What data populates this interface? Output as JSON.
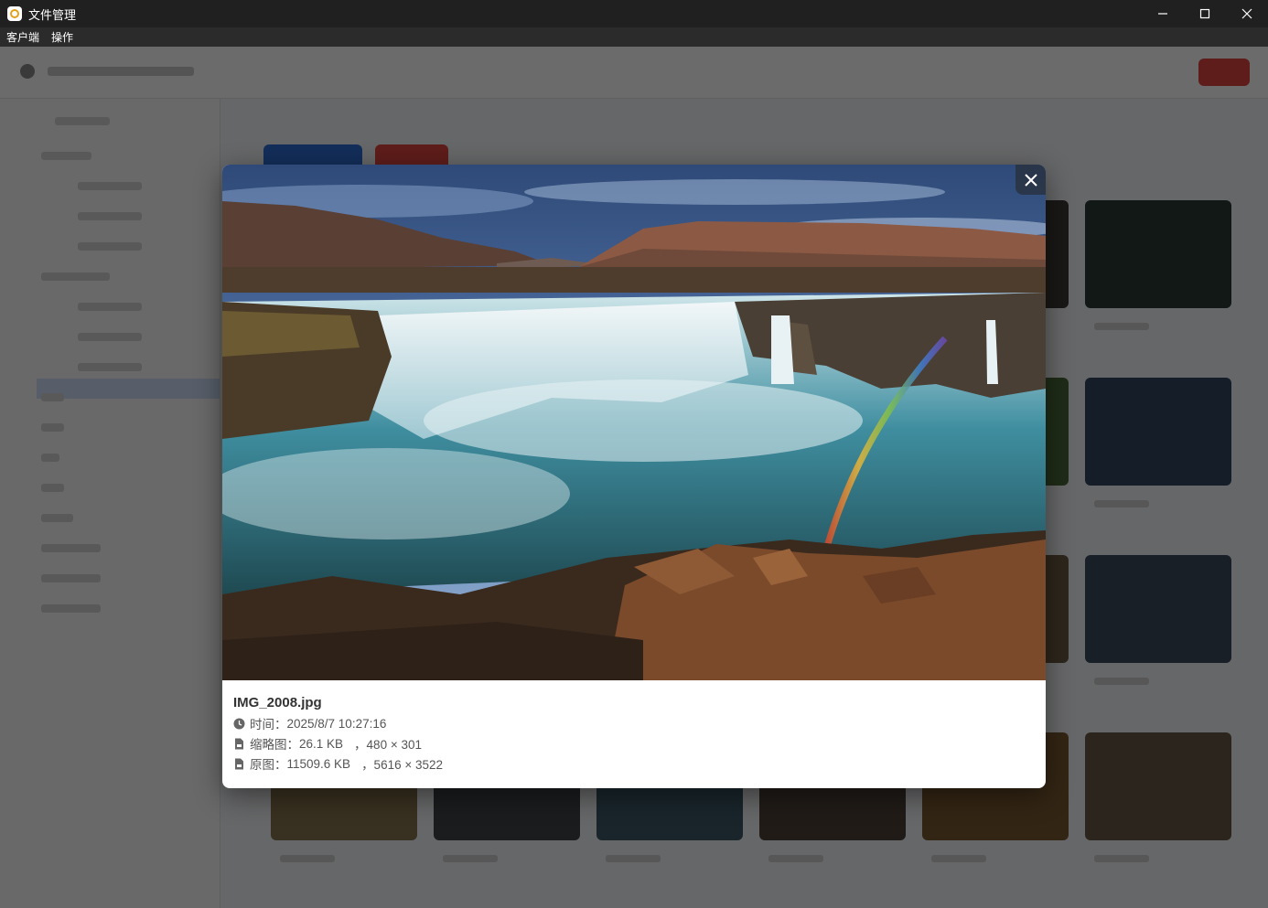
{
  "window": {
    "title": "文件管理"
  },
  "menu": {
    "items": [
      "客户端",
      "操作"
    ]
  },
  "preview": {
    "file_name": "IMG_2008.jpg",
    "time_label": "时间：",
    "time_value": "2025/8/7 10:27:16",
    "thumb_label": "缩略图：",
    "thumb_size": "26.1 KB",
    "thumb_dims": "，480 × 301",
    "orig_label": "原图：",
    "orig_size": "11509.6 KB",
    "orig_dims": "，5616 × 3522"
  },
  "icons": {
    "app": "app-logo-icon",
    "minimize": "minimize-icon",
    "maximize": "maximize-icon",
    "close_window": "close-icon",
    "close_preview": "close-icon",
    "time": "clock-icon",
    "thumb": "file-icon",
    "orig": "file-icon"
  }
}
